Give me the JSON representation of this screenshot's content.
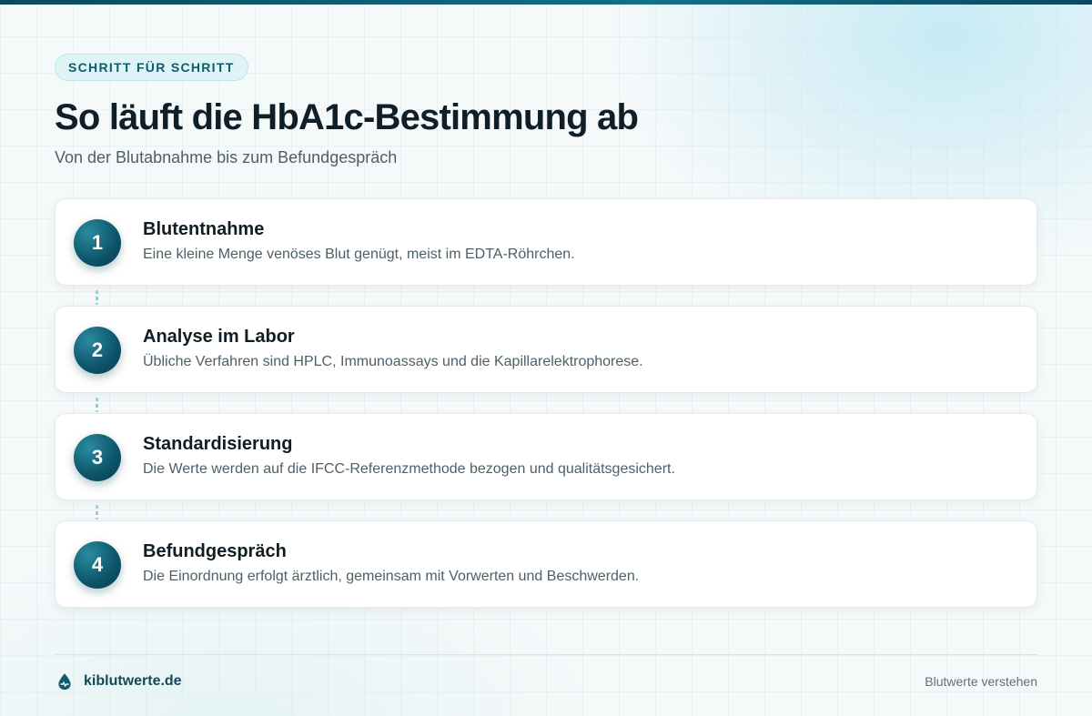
{
  "header": {
    "eyebrow": "SCHRITT FÜR SCHRITT",
    "title": "So läuft die HbA1c-Bestimmung ab",
    "subtitle": "Von der Blutabnahme bis zum Befundgespräch"
  },
  "steps": [
    {
      "number": "1",
      "title": "Blutentnahme",
      "description": "Eine kleine Menge venöses Blut genügt, meist im EDTA-Röhrchen."
    },
    {
      "number": "2",
      "title": "Analyse im Labor",
      "description": "Übliche Verfahren sind HPLC, Immunoassays und die Kapillarelektrophorese."
    },
    {
      "number": "3",
      "title": "Standardisierung",
      "description": "Die Werte werden auf die IFCC-Referenzmethode bezogen und qualitätsgesichert."
    },
    {
      "number": "4",
      "title": "Befundgespräch",
      "description": "Die Einordnung erfolgt ärztlich, gemeinsam mit Vorwerten und Beschwerden."
    }
  ],
  "footer": {
    "brand_icon": "blood-drop-icon",
    "brand": "kiblutwerte.de",
    "tagline": "Blutwerte verstehen"
  },
  "colors": {
    "accent": "#0c5266",
    "accent_light": "#dff4f7",
    "connector": "#8bd1e1",
    "title": "#0f1f29",
    "body_text": "#4d5f69"
  }
}
